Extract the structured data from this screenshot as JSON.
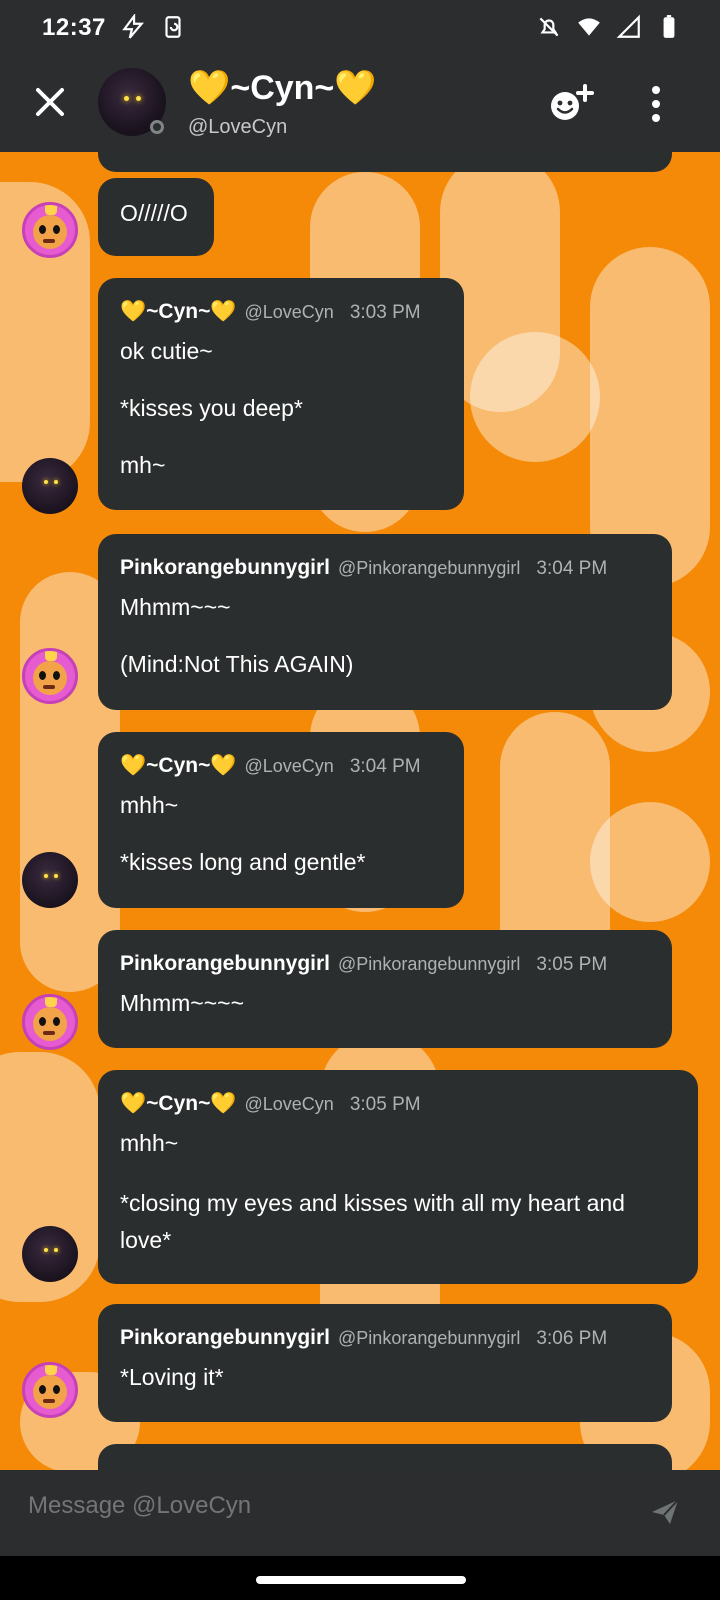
{
  "status_bar": {
    "time": "12:37"
  },
  "header": {
    "name": "💛~Cyn~💛",
    "handle": "@LoveCyn"
  },
  "messages": [
    {
      "author": "",
      "handle": "",
      "time": "",
      "lines": [
        "O/////O"
      ]
    },
    {
      "author": "💛~Cyn~💛",
      "handle": "@LoveCyn",
      "time": "3:03 PM",
      "lines": [
        "ok cutie~",
        "*kisses you deep*",
        "mh~"
      ]
    },
    {
      "author": "Pinkorangebunnygirl",
      "handle": "@Pinkorangebunnygirl",
      "time": "3:04 PM",
      "lines": [
        "Mhmm~~~",
        "(Mind:Not This AGAIN)"
      ]
    },
    {
      "author": "💛~Cyn~💛",
      "handle": "@LoveCyn",
      "time": "3:04 PM",
      "lines": [
        "mhh~",
        "*kisses long and gentle*"
      ]
    },
    {
      "author": "Pinkorangebunnygirl",
      "handle": "@Pinkorangebunnygirl",
      "time": "3:05 PM",
      "lines": [
        "Mhmm~~~~"
      ]
    },
    {
      "author": "💛~Cyn~💛",
      "handle": "@LoveCyn",
      "time": "3:05 PM",
      "lines": [
        "mhh~",
        "*closing my eyes and kisses with all my heart and love*"
      ]
    },
    {
      "author": "Pinkorangebunnygirl",
      "handle": "@Pinkorangebunnygirl",
      "time": "3:06 PM",
      "lines": [
        "*Loving it*"
      ]
    }
  ],
  "composer": {
    "placeholder": "Message @LoveCyn"
  },
  "colors": {
    "chat_background": "#f58a09",
    "bubble": "#2b2e2e",
    "header": "#2b2d2e"
  },
  "icons": {
    "close": "close-icon",
    "add_friend": "add-friend-icon",
    "more": "more-vertical-icon",
    "send": "send-icon"
  }
}
